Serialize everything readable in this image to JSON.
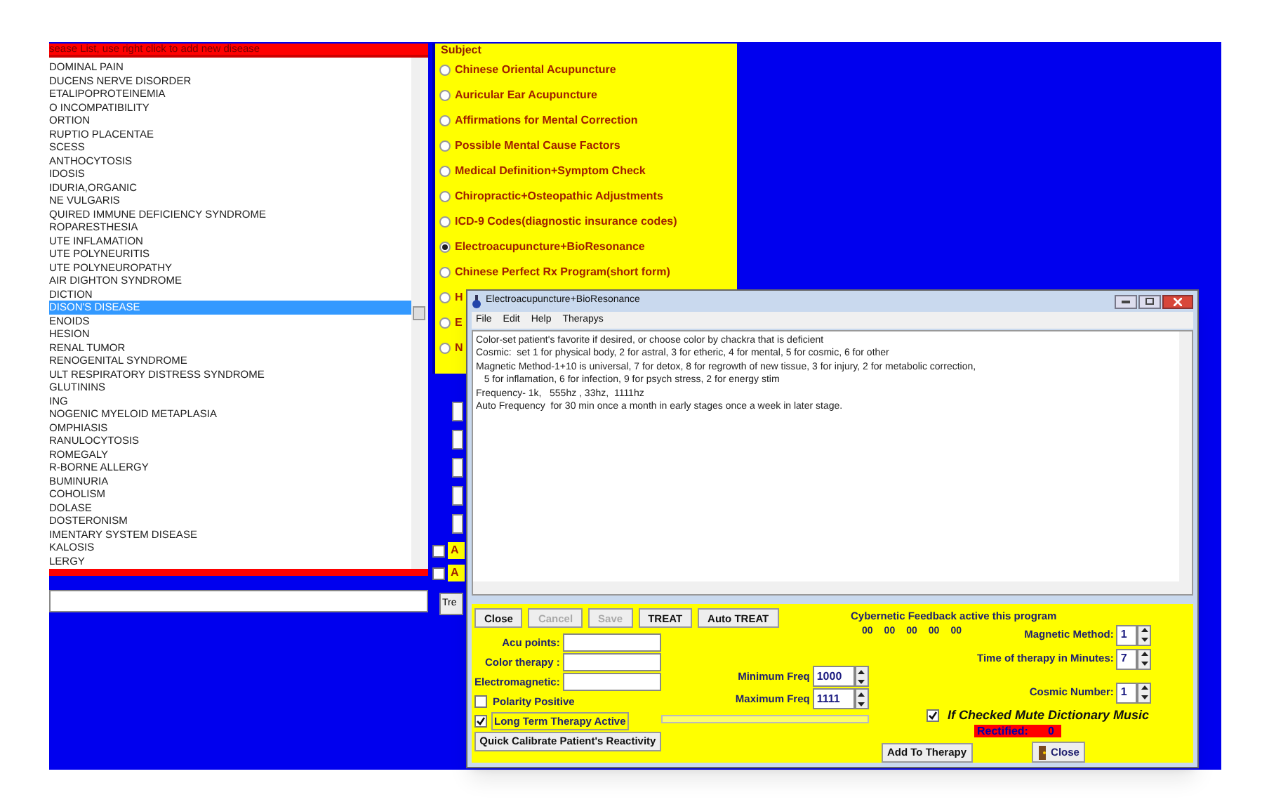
{
  "disease_list": {
    "header": "sease List, use right click to add new disease",
    "items": [
      {
        "label": "DOMINAL PAIN",
        "selected": false
      },
      {
        "label": "DUCENS NERVE DISORDER",
        "selected": false
      },
      {
        "label": "ETALIPOPROTEINEMIA",
        "selected": false
      },
      {
        "label": "O INCOMPATIBILITY",
        "selected": false
      },
      {
        "label": "ORTION",
        "selected": false
      },
      {
        "label": "RUPTIO PLACENTAE",
        "selected": false
      },
      {
        "label": "SCESS",
        "selected": false
      },
      {
        "label": "ANTHOCYTOSIS",
        "selected": false
      },
      {
        "label": "IDOSIS",
        "selected": false
      },
      {
        "label": "IDURIA,ORGANIC",
        "selected": false
      },
      {
        "label": "NE VULGARIS",
        "selected": false
      },
      {
        "label": "QUIRED IMMUNE DEFICIENCY SYNDROME",
        "selected": false
      },
      {
        "label": "ROPARESTHESIA",
        "selected": false
      },
      {
        "label": "UTE INFLAMATION",
        "selected": false
      },
      {
        "label": "UTE POLYNEURITIS",
        "selected": false
      },
      {
        "label": "UTE POLYNEUROPATHY",
        "selected": false
      },
      {
        "label": "AIR DIGHTON SYNDROME",
        "selected": false
      },
      {
        "label": "DICTION",
        "selected": false
      },
      {
        "label": "DISON'S DISEASE",
        "selected": true
      },
      {
        "label": "ENOIDS",
        "selected": false
      },
      {
        "label": "HESION",
        "selected": false
      },
      {
        "label": "RENAL TUMOR",
        "selected": false
      },
      {
        "label": "RENOGENITAL SYNDROME",
        "selected": false
      },
      {
        "label": "ULT RESPIRATORY DISTRESS SYNDROME",
        "selected": false
      },
      {
        "label": "GLUTININS",
        "selected": false
      },
      {
        "label": "ING",
        "selected": false
      },
      {
        "label": "NOGENIC MYELOID METAPLASIA",
        "selected": false
      },
      {
        "label": "OMPHIASIS",
        "selected": false
      },
      {
        "label": "RANULOCYTOSIS",
        "selected": false
      },
      {
        "label": "ROMEGALY",
        "selected": false
      },
      {
        "label": "R-BORNE ALLERGY",
        "selected": false
      },
      {
        "label": "BUMINURIA",
        "selected": false
      },
      {
        "label": "COHOLISM",
        "selected": false
      },
      {
        "label": "DOLASE",
        "selected": false
      },
      {
        "label": "DOSTERONISM",
        "selected": false
      },
      {
        "label": "IMENTARY SYSTEM DISEASE",
        "selected": false
      },
      {
        "label": "KALOSIS",
        "selected": false
      },
      {
        "label": "LERGY",
        "selected": false
      }
    ]
  },
  "subject": {
    "title": "Subject",
    "options": [
      {
        "label": "Chinese Oriental Acupuncture",
        "selected": false
      },
      {
        "label": "Auricular Ear Acupuncture",
        "selected": false
      },
      {
        "label": "Affirmations for Mental Correction",
        "selected": false
      },
      {
        "label": "Possible Mental Cause Factors",
        "selected": false
      },
      {
        "label": "Medical Definition+Symptom Check",
        "selected": false
      },
      {
        "label": "Chiropractic+Osteopathic Adjustments",
        "selected": false
      },
      {
        "label": "ICD-9 Codes(diagnostic insurance codes)",
        "selected": false
      },
      {
        "label": "Electroacupuncture+BioResonance",
        "selected": true
      },
      {
        "label": "Chinese Perfect Rx Program(short form)",
        "selected": false
      },
      {
        "label": "H",
        "selected": false
      },
      {
        "label": "E",
        "selected": false
      },
      {
        "label": "N",
        "selected": false
      }
    ]
  },
  "behind_checkboxes": [
    {
      "label": "A",
      "checked": false
    },
    {
      "label": "A",
      "checked": false
    }
  ],
  "behind_button": "Tre",
  "dialog": {
    "title": "Electroacupuncture+BioResonance",
    "menu": [
      "File",
      "Edit",
      "Help",
      "Therapys"
    ],
    "notes": [
      "Color-set patient's favorite if desired, or choose color by chackra that is deficient",
      "Cosmic:  set 1 for physical body, 2 for astral, 3 for etheric, 4 for mental, 5 for cosmic, 6 for other",
      "Magnetic Method-1+10 is universal, 7 for detox, 8 for regrowth of new tissue, 3 for injury, 2 for metabolic correction,",
      "   5 for inflamation, 6 for infection, 9 for psych stress, 2 for energy stim",
      "Frequency- 1k,   555hz , 33hz,  1111hz",
      "Auto Frequency  for 30 min once a month in early stages once a week in later stage."
    ],
    "buttons": [
      {
        "label": "Close",
        "disabled": false
      },
      {
        "label": "Cancel",
        "disabled": true
      },
      {
        "label": "Save",
        "disabled": true
      },
      {
        "label": "TREAT",
        "disabled": false
      },
      {
        "label": "Auto TREAT",
        "disabled": false
      }
    ],
    "feedback": {
      "title": "Cybernetic Feedback active this program",
      "values": [
        "00",
        "00",
        "00",
        "00",
        "00"
      ]
    },
    "fields": [
      "Acu points:",
      "Color therapy :",
      "Electromagnetic:"
    ],
    "frequencies": [
      {
        "label": "Minimum Freq",
        "value": "1000"
      },
      {
        "label": "Maximum Freq",
        "value": "1111"
      }
    ],
    "options": [
      {
        "label": "Polarity Positive",
        "checked": false
      },
      {
        "label": "Long Term Therapy Active",
        "checked": true
      }
    ],
    "calibrate_button": "Quick Calibrate Patient's Reactivity",
    "progress": {
      "level": 0
    },
    "spinners": [
      {
        "label": "Magnetic Method:",
        "value": "1"
      },
      {
        "label": "Time of therapy in Minutes:",
        "value": "7"
      },
      {
        "label": "Cosmic Number:",
        "value": "1"
      }
    ],
    "mute": {
      "label": "If Checked Mute Dictionary Music",
      "checked": true
    },
    "rectified": {
      "label": "Rectified:",
      "value": "0"
    },
    "add_button": "Add To Therapy",
    "close_button": "Close"
  }
}
